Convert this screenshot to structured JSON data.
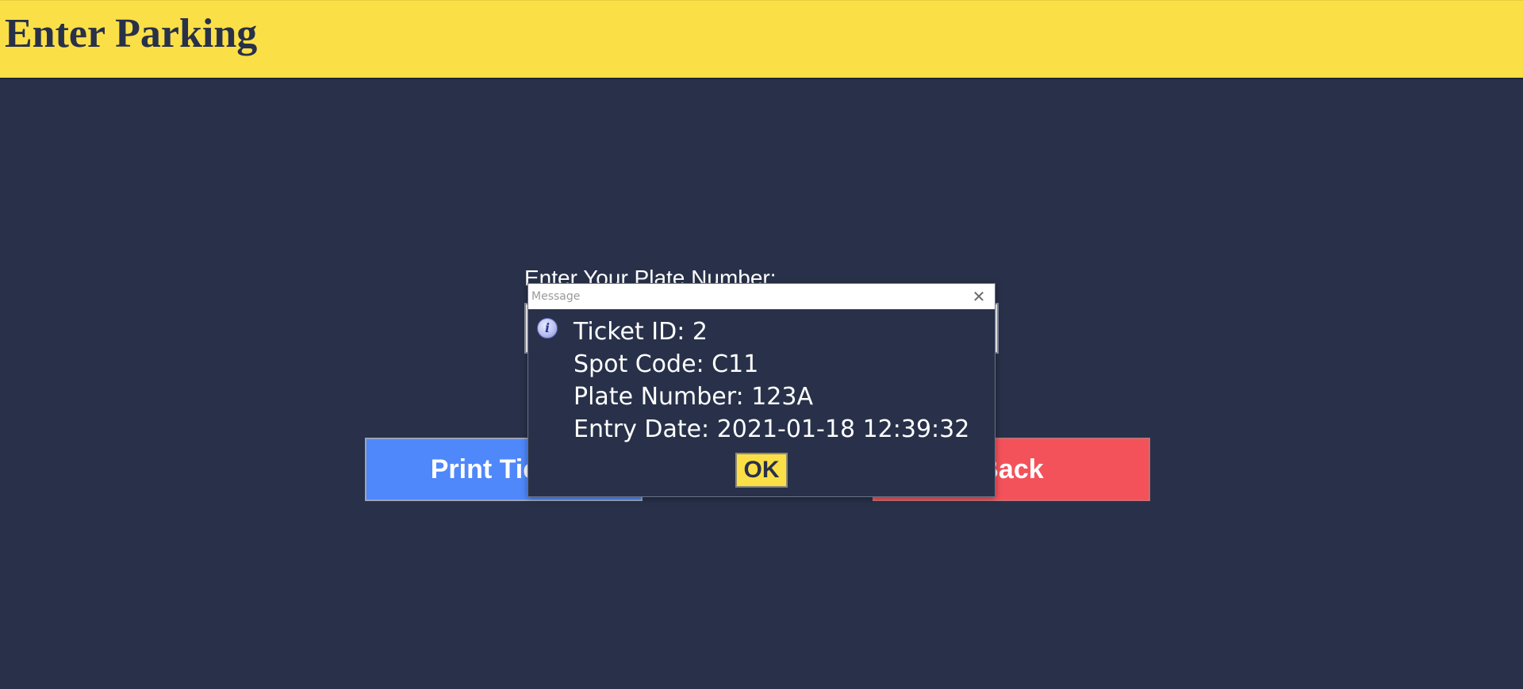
{
  "header": {
    "title": "Enter Parking"
  },
  "form": {
    "plate_label": "Enter Your Plate Number:",
    "plate_value": ""
  },
  "buttons": {
    "print_label": "Print Ticket",
    "back_label": "Back"
  },
  "dialog": {
    "title": "Message",
    "close_glyph": "✕",
    "icon": "info-icon",
    "icon_glyph": "i",
    "lines": [
      "Ticket ID: 2",
      "Spot Code: C11",
      "Plate Number: 123A",
      "Entry Date: 2021-01-18 12:39:32"
    ],
    "ok_label": "OK"
  },
  "colors": {
    "background": "#283149",
    "header": "#fbdf47",
    "print_button": "#4f88fa",
    "back_button": "#f4525a",
    "ok_button": "#fbdf47"
  }
}
